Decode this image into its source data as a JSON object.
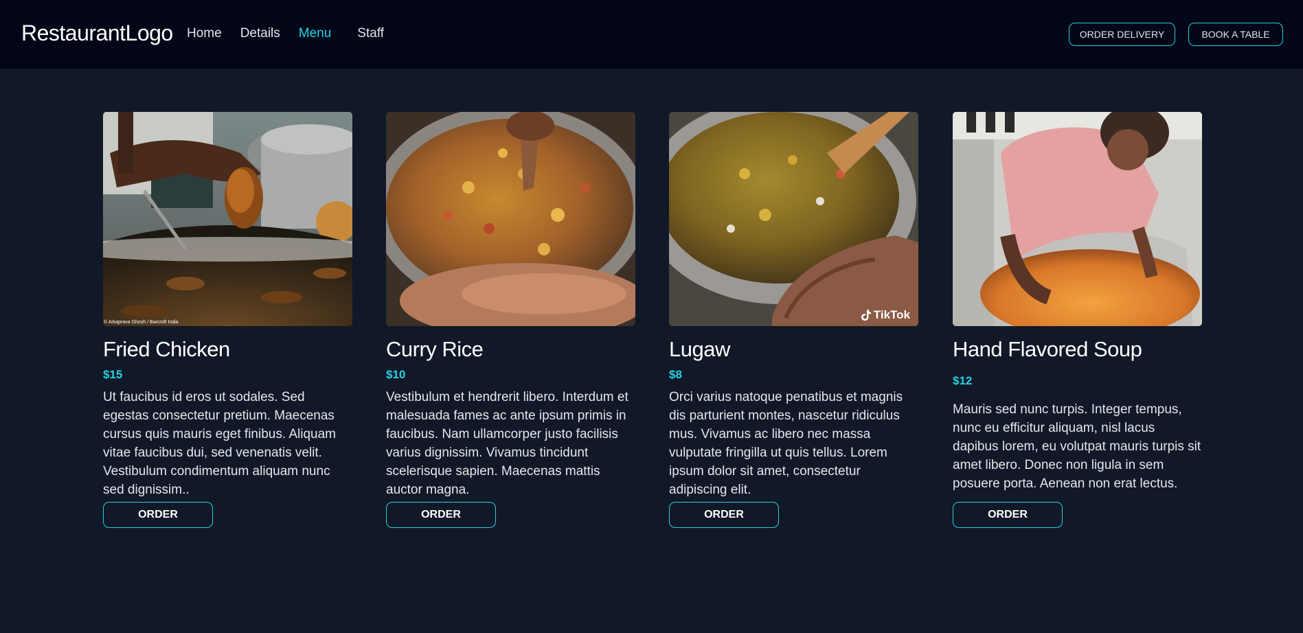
{
  "header": {
    "logo": "RestaurantLogo",
    "nav": [
      {
        "label": "Home",
        "active": false
      },
      {
        "label": "Details",
        "active": false
      },
      {
        "label": "Menu",
        "active": true
      },
      {
        "label": "Staff",
        "active": false
      }
    ],
    "order_delivery_label": "ORDER DELIVERY",
    "book_table_label": "BOOK A TABLE"
  },
  "colors": {
    "background": "#111827",
    "header_background": "#030617",
    "accent": "#22d3e4"
  },
  "menu": {
    "items": [
      {
        "name": "Fried Chicken",
        "price": "$15",
        "description": "Ut faucibus id eros ut sodales. Sed egestas consectetur pretium. Maecenas cursus quis mauris eget finibus. Aliquam vitae faucibus dui, sed venenatis velit. Vestibulum condimentum aliquam nunc sed dignissim..",
        "order_label": "ORDER",
        "image_credit": "© Arkaprava Ghosh / Barcroft India"
      },
      {
        "name": "Curry Rice",
        "price": "$10",
        "description": "Vestibulum et hendrerit libero. Interdum et malesuada fames ac ante ipsum primis in faucibus. Nam ullamcorper justo facilisis varius dignissim. Vivamus tincidunt scelerisque sapien. Maecenas mattis auctor magna.",
        "order_label": "ORDER"
      },
      {
        "name": "Lugaw",
        "price": "$8",
        "description": "Orci varius natoque penatibus et magnis dis parturient montes, nascetur ridiculus mus. Vivamus ac libero nec massa vulputate fringilla ut quis tellus. Lorem ipsum dolor sit amet, consectetur adipiscing elit.",
        "order_label": "ORDER",
        "image_watermark": "TikTok"
      },
      {
        "name": "Hand Flavored Soup",
        "price": "$12",
        "description": "Mauris sed nunc turpis. Integer tempus, nunc eu efficitur aliquam, nisl lacus dapibus lorem, eu volutpat mauris turpis sit amet libero. Donec non ligula in sem posuere porta. Aenean non erat lectus.",
        "order_label": "ORDER"
      }
    ]
  }
}
